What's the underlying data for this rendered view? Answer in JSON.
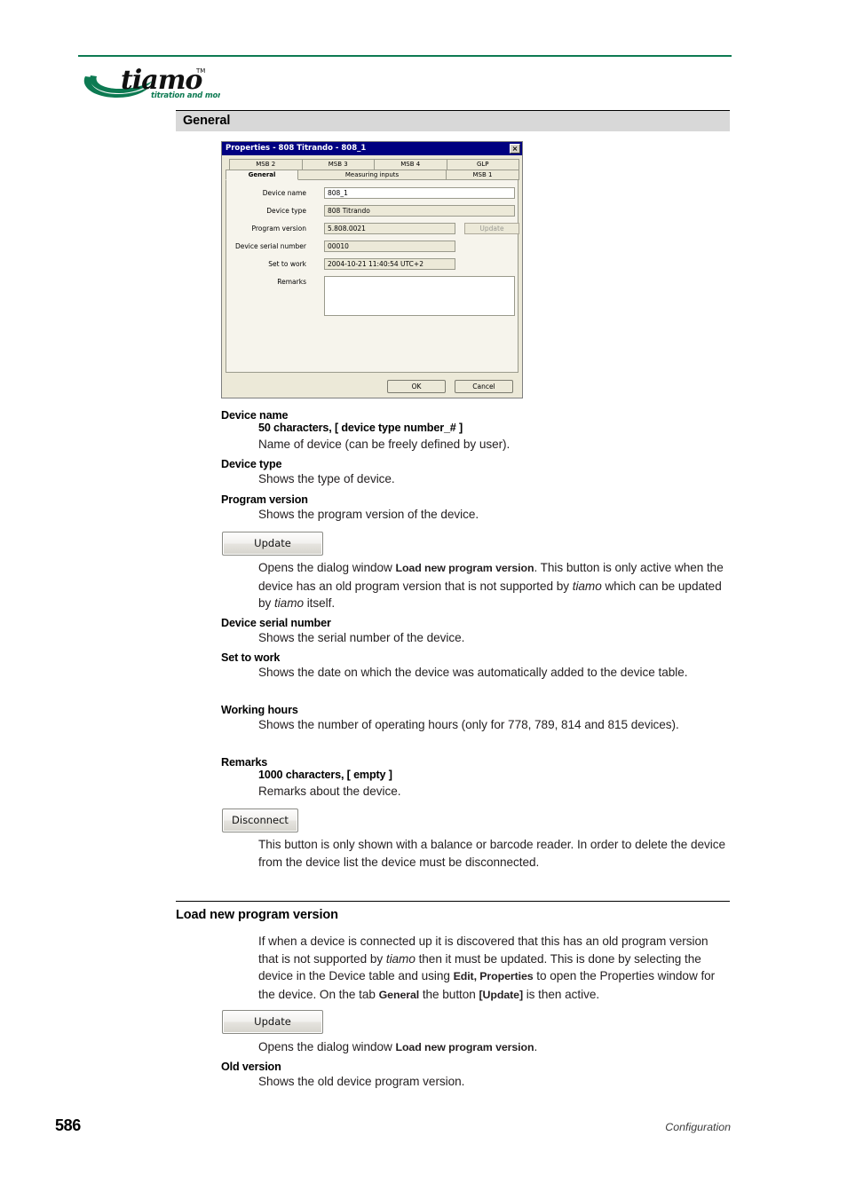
{
  "brand": {
    "name": "tiamo",
    "trademark": "TM",
    "tagline": "titration and more",
    "accent_color": "#0d7a52"
  },
  "sections": {
    "general": {
      "heading": "General"
    },
    "load_new_program_version": {
      "heading": "Load new program version",
      "intro": "If when a device is connected up it is discovered that this has an old program version that is not supported by <i>tiamo</i> then it must be updated. This is done by selecting the device in the Device table and using <b>Edit, Properties</b> to open the Properties window for the device. On the tab <b>General</b> the button <b>[Update]</b> is then active."
    }
  },
  "dialog": {
    "title": "Properties - 808 Titrando - 808_1",
    "close_label": "×",
    "tabs_row1": [
      "MSB 2",
      "MSB 3",
      "MSB 4",
      "GLP"
    ],
    "tabs_row2": [
      "General",
      "Measuring inputs",
      "MSB 1"
    ],
    "active_tab": "General",
    "fields": [
      {
        "label": "Device name",
        "value": "808_1",
        "editable": true
      },
      {
        "label": "Device type",
        "value": "808 Titrando",
        "editable": false
      },
      {
        "label": "Program version",
        "value": "5.808.0021",
        "editable": false
      },
      {
        "label": "Device serial number",
        "value": "00010",
        "editable": false
      },
      {
        "label": "Set to work",
        "value": "2004-10-21 11:40:54 UTC+2",
        "editable": false
      }
    ],
    "update_button": "Update",
    "remarks_label": "Remarks",
    "remarks_value": "",
    "ok_button": "OK",
    "cancel_button": "Cancel",
    "titlebar_color": "#000080"
  },
  "entries": [
    {
      "term": "Device name",
      "spec": "50 characters, [ device type number_# ]",
      "text": "Name of device (can be freely defined by user)."
    },
    {
      "term": "Device type",
      "text": "Shows the type of device."
    },
    {
      "term": "Program version",
      "text": "Shows the program version of the device."
    },
    {
      "term": "Device serial number",
      "text": "Shows the serial number of the device."
    },
    {
      "term": "Set to work",
      "text": "Shows the date on which the device was automatically added to the device table."
    },
    {
      "term": "Working hours",
      "text": "Shows the number of operating hours (only for 778, 789, 814 and 815 devices)."
    },
    {
      "term": "Remarks",
      "spec": "1000 characters, [ empty ]",
      "text": "Remarks about the device."
    },
    {
      "term": "Old version",
      "text": "Shows the old device program version."
    }
  ],
  "buttons": {
    "update": "Update",
    "disconnect": "Disconnect"
  },
  "descriptions": {
    "update_general": "Opens the dialog window <b>Load new program version</b>. This button is only active when the device has an old program version that is not supported by <i>tiamo</i> which can be updated by <i>tiamo</i> itself.",
    "disconnect": "This button is only shown with a balance or barcode reader. In order to delete the device from the device list the device must be disconnected.",
    "update_short": "Opens the dialog window <b>Load new program version</b>."
  },
  "footer": {
    "page_number": "586",
    "chapter": "Configuration"
  }
}
